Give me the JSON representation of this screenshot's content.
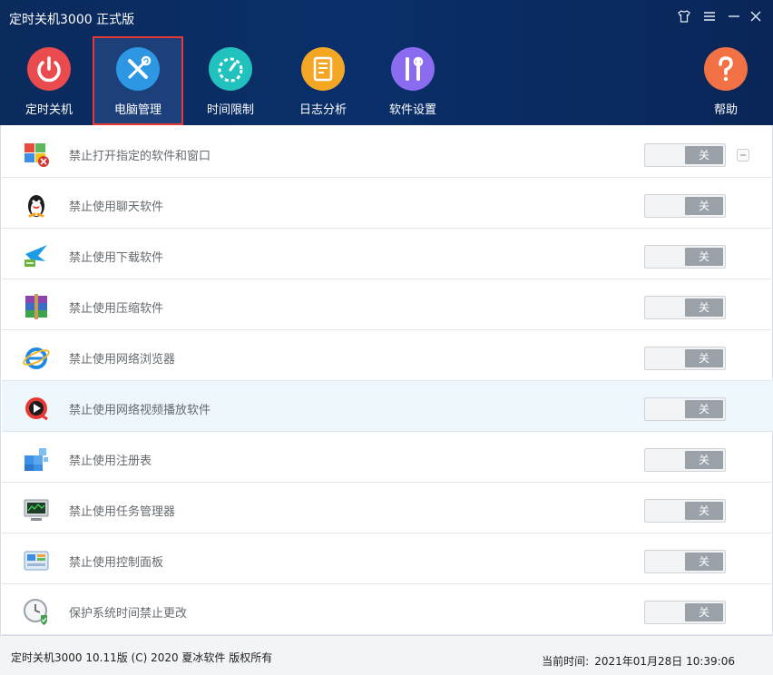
{
  "window": {
    "title": "定时关机3000 正式版",
    "controls": [
      {
        "name": "skin-icon",
        "glyph": "👕"
      },
      {
        "name": "menu-icon",
        "glyph": "☰"
      },
      {
        "name": "minimize-icon",
        "glyph": "—"
      },
      {
        "name": "close-icon",
        "glyph": "✕"
      }
    ]
  },
  "nav": {
    "items": [
      {
        "label": "定时关机",
        "icon": "power-icon",
        "color": "#e94b4f"
      },
      {
        "label": "电脑管理",
        "icon": "tools-icon",
        "color": "#2d97e4",
        "active": true
      },
      {
        "label": "时间限制",
        "icon": "timer-icon",
        "color": "#21c1bd"
      },
      {
        "label": "日志分析",
        "icon": "log-icon",
        "color": "#f3a725"
      },
      {
        "label": "软件设置",
        "icon": "settings-tools-icon",
        "color": "#8b6cf0"
      },
      {
        "label": "帮助",
        "icon": "help-icon",
        "color": "#f27145"
      }
    ]
  },
  "rows": [
    {
      "label": "禁止打开指定的软件和窗口",
      "icon": "window-block-icon",
      "toggle": "关"
    },
    {
      "label": "禁止使用聊天软件",
      "icon": "qq-penguin-icon",
      "toggle": "关"
    },
    {
      "label": "禁止使用下载软件",
      "icon": "thunder-download-icon",
      "toggle": "关"
    },
    {
      "label": "禁止使用压缩软件",
      "icon": "winrar-icon",
      "toggle": "关"
    },
    {
      "label": "禁止使用网络浏览器",
      "icon": "ie-browser-icon",
      "toggle": "关"
    },
    {
      "label": "禁止使用网络视频播放软件",
      "icon": "video-player-icon",
      "toggle": "关"
    },
    {
      "label": "禁止使用注册表",
      "icon": "registry-icon",
      "toggle": "关"
    },
    {
      "label": "禁止使用任务管理器",
      "icon": "task-manager-icon",
      "toggle": "关"
    },
    {
      "label": "禁止使用控制面板",
      "icon": "control-panel-icon",
      "toggle": "关"
    },
    {
      "label": "保护系统时间禁止更改",
      "icon": "clock-shield-icon",
      "toggle": "关"
    }
  ],
  "status": {
    "left": "定时关机3000 10.11版 (C) 2020  夏冰软件 版权所有",
    "time_label": "当前时间:",
    "time_value": "2021年01月28日 10:39:06"
  }
}
